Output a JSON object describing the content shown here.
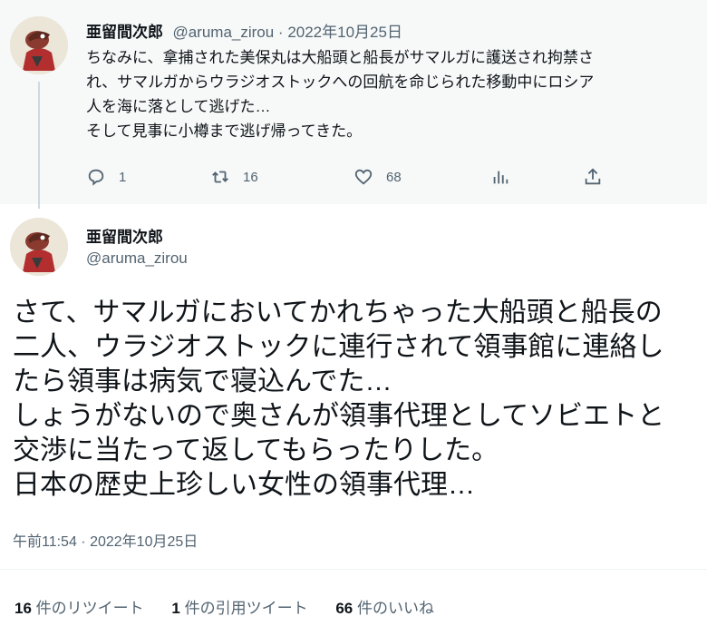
{
  "tweet1": {
    "author_name": "亜留間次郎",
    "author_handle": "@aruma_zirou",
    "separator": " · ",
    "date": "2022年10月25日",
    "lines": [
      "ちなみに、拿捕された美保丸は大船頭と船長がサマルガに護送され拘禁さ",
      "れ、サマルガからウラジオストックへの回航を命じられた移動中にロシア",
      "人を海に落として逃げた…",
      "そして見事に小樽まで逃げ帰ってきた。"
    ],
    "actions": {
      "reply_count": "1",
      "retweet_count": "16",
      "like_count": "68",
      "reply_icon": "reply-icon",
      "retweet_icon": "retweet-icon",
      "like_icon": "heart-icon",
      "views_icon": "analytics-icon",
      "share_icon": "share-icon"
    }
  },
  "tweet2": {
    "author_name": "亜留間次郎",
    "author_handle": "@aruma_zirou",
    "lines": [
      "さて、サマルガにおいてかれちゃった大船頭と船長の",
      "二人、ウラジオストックに連行されて領事館に連絡し",
      "たら領事は病気で寝込んでた…",
      "しょうがないので奥さんが領事代理としてソビエトと",
      "交渉に当たって返してもらったりした。",
      "日本の歴史上珍しい女性の領事代理…"
    ],
    "time": "午前11:54",
    "separator": " · ",
    "date": "2022年10月25日",
    "stats": {
      "retweets_num": "16",
      "retweets_label": " 件のリツイート",
      "quotes_num": "1",
      "quotes_label": " 件の引用ツイート",
      "likes_num": "66",
      "likes_label": " 件のいいね"
    }
  },
  "colors": {
    "text": "#0f1419",
    "secondary": "#536471",
    "thread_line": "#cfd9de",
    "hover_bg": "#f7f9f9"
  }
}
